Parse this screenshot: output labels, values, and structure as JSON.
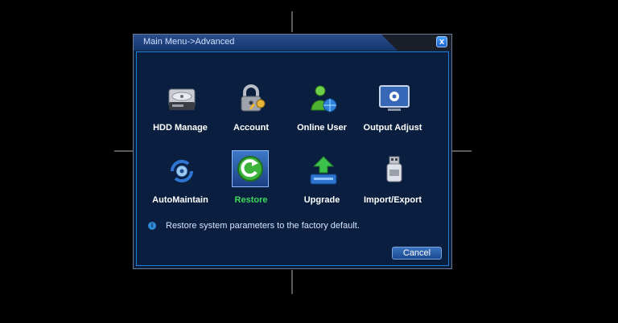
{
  "window": {
    "title": "Main Menu->Advanced",
    "close_label": "x"
  },
  "menu": {
    "items": [
      {
        "label": "HDD Manage",
        "icon": "hdd-icon"
      },
      {
        "label": "Account",
        "icon": "lock-key-icon"
      },
      {
        "label": "Online User",
        "icon": "user-globe-icon"
      },
      {
        "label": "Output Adjust",
        "icon": "monitor-gear-icon"
      },
      {
        "label": "AutoMaintain",
        "icon": "maintain-icon"
      },
      {
        "label": "Restore",
        "icon": "restore-icon",
        "selected": true
      },
      {
        "label": "Upgrade",
        "icon": "upgrade-icon"
      },
      {
        "label": "Import/Export",
        "icon": "usb-drive-icon"
      }
    ]
  },
  "info": {
    "text": "Restore system parameters to the factory default.",
    "icon": "info-icon"
  },
  "buttons": {
    "cancel_label": "Cancel"
  },
  "colors": {
    "panel": "#0a1f3f",
    "border": "#1f7fd6",
    "selected_label": "#3ed95a"
  }
}
